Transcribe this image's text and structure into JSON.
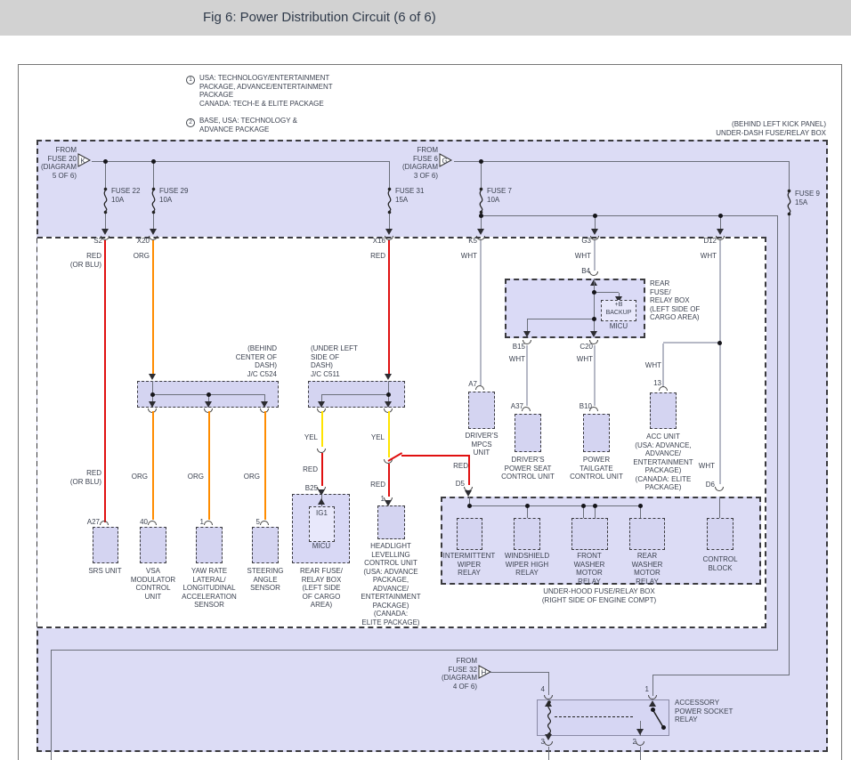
{
  "title": "Fig 6: Power Distribution Circuit (6 of 6)",
  "legend": {
    "n1": "1",
    "t1": "USA: TECHNOLOGY/ENTERTAINMENT\nPACKAGE, ADVANCE/ENTERTAINMENT\nPACKAGE\nCANADA: TECH-E & ELITE PACKAGE",
    "n2": "2",
    "t2": "BASE, USA: TECHNOLOGY &\nADVANCE PACKAGE"
  },
  "under_dash_note": "(BEHIND LEFT KICK PANEL)\nUNDER-DASH FUSE/RELAY BOX",
  "src": {
    "f20": "FROM\nFUSE 20\n(DIAGRAM\n5 OF 6)",
    "f20tag": "K",
    "f6": "FROM\nFUSE 6\n(DIAGRAM\n3 OF 6)",
    "f6tag": "G",
    "f32": "FROM\nFUSE 32\n(DIAGRAM\n4 OF 6)",
    "f32tag": "H"
  },
  "fuses": {
    "f22": "FUSE 22\n10A",
    "f29": "FUSE 29\n10A",
    "f31": "FUSE 31\n15A",
    "f7": "FUSE 7\n10A",
    "f9": "FUSE 9\n15A"
  },
  "pins": {
    "s2": "S2",
    "x20": "X20",
    "x16": "X16",
    "k5": "K5",
    "g3": "G3",
    "d12": "D12",
    "b4": "B4",
    "b15": "B15",
    "c20": "C20",
    "p13": "13",
    "a7": "A7",
    "a37": "A37",
    "b10": "B10",
    "a27": "A27",
    "p40": "40",
    "p1": "1",
    "p5": "5",
    "b25": "B25",
    "d5": "D5",
    "d6": "D6",
    "p4": "4",
    "p3": "3",
    "p2": "2"
  },
  "wires": {
    "red": "RED",
    "red_or_blu": "RED\n(OR BLU)",
    "org": "ORG",
    "wht": "WHT",
    "yel": "YEL"
  },
  "jc": {
    "c524": "(BEHIND\nCENTER OF\nDASH)\nJ/C C524",
    "c511": "(UNDER LEFT\nSIDE OF\nDASH)\nJ/C C511"
  },
  "boxes": {
    "rear_top": "REAR\nFUSE/\nRELAY BOX\n(LEFT SIDE OF\nCARGO AREA)",
    "backup": "+B\nBACKUP",
    "micu": "MICU",
    "ig1": "IG1",
    "rear_bottom": "REAR FUSE/\nRELAY BOX\n(LEFT SIDE\nOF CARGO\nAREA)",
    "under_hood": "UNDER-HOOD FUSE/RELAY BOX\n(RIGHT SIDE OF ENGINE COMPT)"
  },
  "comp": {
    "mpcs": "DRIVER'S\nMPCS\nUNIT",
    "seat": "DRIVER'S\nPOWER SEAT\nCONTROL UNIT",
    "tailgate": "POWER\nTAILGATE\nCONTROL UNIT",
    "acc": "ACC UNIT\n(USA: ADVANCE,\nADVANCE/\nENTERTAINMENT\nPACKAGE)\n(CANADA: ELITE\nPACKAGE)",
    "srs": "SRS UNIT",
    "vsa": "VSA\nMODULATOR\nCONTROL\nUNIT",
    "yaw": "YAW RATE\nLATERAL/\nLONGITUDINAL\nACCELERATION\nSENSOR",
    "steer": "STEERING\nANGLE\nSENSOR",
    "headlight": "HEADLIGHT\nLEVELLING\nCONTROL UNIT\n(USA: ADVANCE\nPACKAGE,\nADVANCE/\nENTERTAINMENT\nPACKAGE)\n(CANADA:\nELITE PACKAGE)",
    "int_wiper": "INTERMITTENT\nWIPER\nRELAY",
    "wshield": "WINDSHIELD\nWIPER HIGH\nRELAY",
    "fwasher": "FRONT\nWASHER\nMOTOR\nRELAY",
    "rwasher": "REAR\nWASHER\nMOTOR\nRELAY",
    "ctrl": "CONTROL\nBLOCK",
    "acc_relay": "ACCESSORY\nPOWER SOCKET\nRELAY"
  },
  "colors": {
    "titlebar_bg": "#d2d2d2",
    "band_fill": "#dcdcf5",
    "box_fill": "#d4d4f1",
    "wire_red": "#e01010",
    "wire_orange": "#ff8c00",
    "wire_yellow": "#ffe400",
    "wire_white": "#b6b9c6",
    "bus_gray": "#6b6f7a",
    "text": "#3c4250"
  }
}
